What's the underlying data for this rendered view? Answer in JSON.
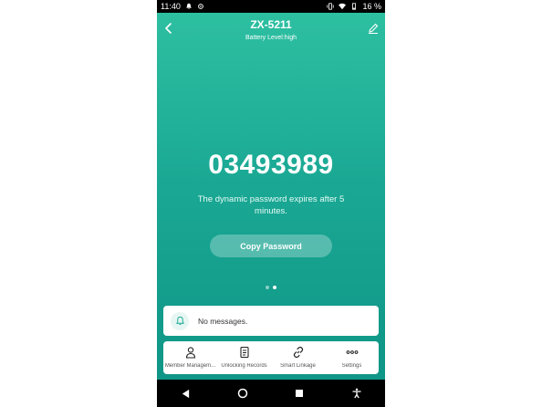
{
  "status_bar": {
    "time": "11:40",
    "battery": "16 %"
  },
  "header": {
    "title": "ZX-5211",
    "subtitle": "Battery Level:high"
  },
  "password": {
    "code": "03493989",
    "description": "The dynamic password expires after 5 minutes.",
    "copy_label": "Copy Password"
  },
  "pager": {
    "count": 2,
    "active_index": 1
  },
  "messages": {
    "text": "No messages."
  },
  "bottom_nav": {
    "items": [
      {
        "label": "Member Managem...",
        "icon": "person-icon"
      },
      {
        "label": "Unlocking Records",
        "icon": "document-icon"
      },
      {
        "label": "Smart Linkage",
        "icon": "link-icon"
      },
      {
        "label": "Settings",
        "icon": "more-dots-icon"
      }
    ]
  },
  "colors": {
    "gradient_top": "#2fc1a2",
    "gradient_bottom": "#0e9384",
    "accent": "#1aa894"
  }
}
